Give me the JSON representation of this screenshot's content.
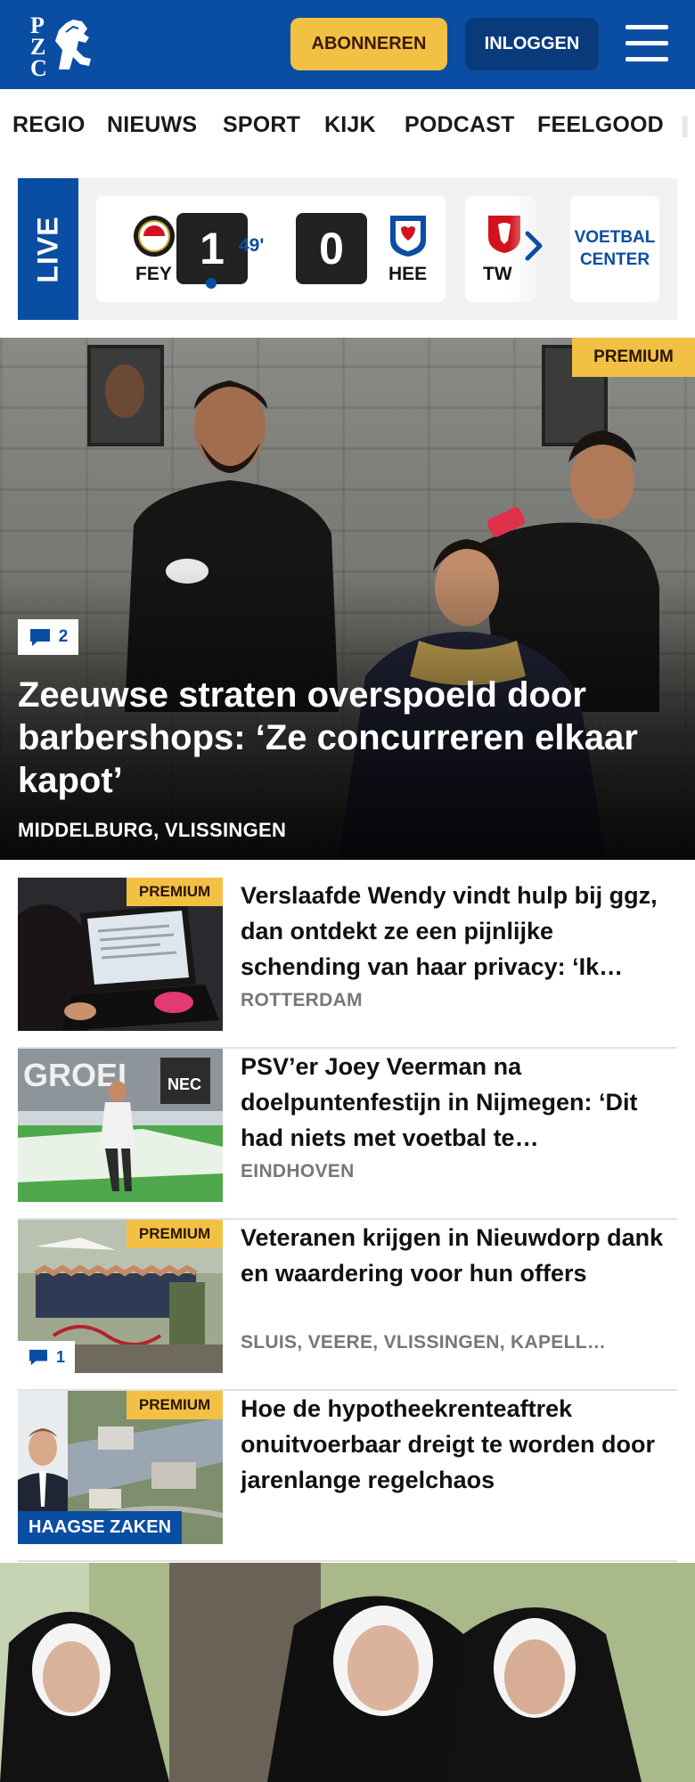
{
  "header": {
    "logo_letters": [
      "P",
      "Z",
      "C"
    ],
    "subscribe_label": "ABONNEREN",
    "login_label": "INLOGGEN",
    "menu_icon": "hamburger-icon",
    "colors": {
      "brand_blue": "#0a4ea3",
      "subscribe_yellow": "#f2c043",
      "login_dark": "#083a7c"
    }
  },
  "nav": {
    "items": [
      "REGIO",
      "NIEUWS",
      "SPORT",
      "KIJK",
      "PODCAST",
      "FEELGOOD"
    ]
  },
  "live": {
    "label": "LIVE",
    "match": {
      "home": "FEY",
      "away": "HEE",
      "home_score": "1",
      "away_score": "0",
      "minute": "49'"
    },
    "next_team": "TW",
    "voetbal_center": [
      "VOETBAL",
      "CENTER"
    ]
  },
  "hero": {
    "premium": "PREMIUM",
    "comments": "2",
    "title": "Zeeuwse straten overspoeld door barbershops: ‘Ze concurreren elkaar kapot’",
    "location": "MIDDELBURG, VLISSINGEN"
  },
  "articles": [
    {
      "premium": "PREMIUM",
      "title": "Verslaafde Wendy vindt hulp bij ggz, dan ontdekt ze een pijnlijke schending van haar privacy: ‘Ik…",
      "location": "ROTTERDAM"
    },
    {
      "title": "PSV’er Joey Veerman na doelpuntenfestijn in Nijmegen: ‘Dit had niets met voetbal te…",
      "location": "EINDHOVEN"
    },
    {
      "premium": "PREMIUM",
      "comments": "1",
      "title": "Veteranen krijgen in Nieuwdorp dank en waardering voor hun offers",
      "location": "SLUIS, VEERE, VLISSINGEN, KAPELL…"
    },
    {
      "premium": "PREMIUM",
      "tag": "HAAGSE ZAKEN",
      "title": "Hoe de hypotheekrenteaftrek onuitvoerbaar dreigt te worden door jarenlange regelchaos"
    }
  ]
}
